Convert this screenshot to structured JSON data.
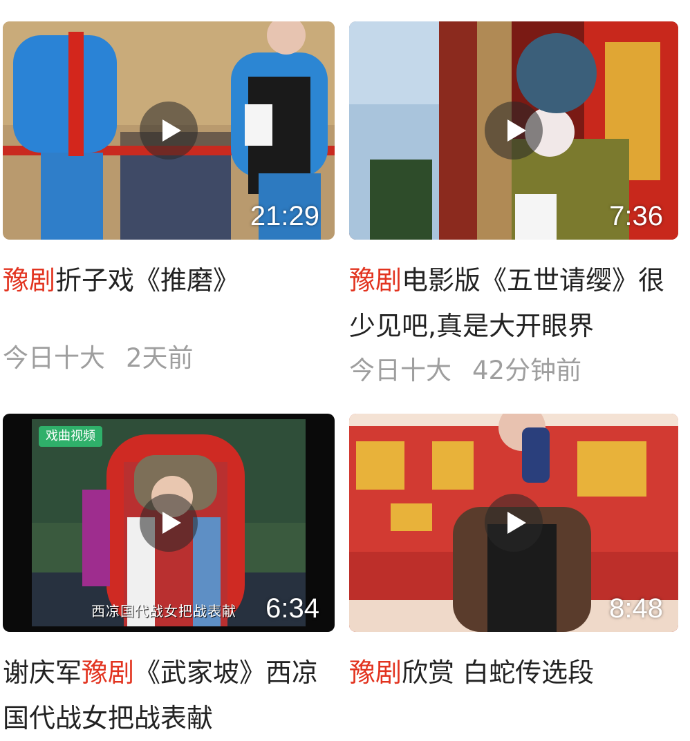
{
  "feed": {
    "videos": [
      {
        "duration": "21:29",
        "title_keyword": "豫剧",
        "title_prefix": "",
        "title_rest": "折子戏《推磨》",
        "source": "今日十大",
        "time_ago": "2天前"
      },
      {
        "duration": "7:36",
        "title_keyword": "豫剧",
        "title_prefix": "",
        "title_rest": "电影版《五世请缨》很少见吧,真是大开眼界",
        "source": "今日十大",
        "time_ago": "42分钟前"
      },
      {
        "duration": "6:34",
        "title_keyword": "豫剧",
        "title_prefix": "谢庆军",
        "title_rest": "《武家坡》西凉国代战女把战表献",
        "channel_tag": "戏曲视频",
        "subtitle_overlay": "西凉国代战女把战表献"
      },
      {
        "duration": "8:48",
        "title_keyword": "豫剧",
        "title_prefix": "",
        "title_rest": "欣赏 白蛇传选段"
      }
    ]
  },
  "colors": {
    "keyword": "#e2331f",
    "title": "#222222",
    "meta": "#9e9e9e"
  },
  "icons": {
    "play": "play-icon"
  }
}
